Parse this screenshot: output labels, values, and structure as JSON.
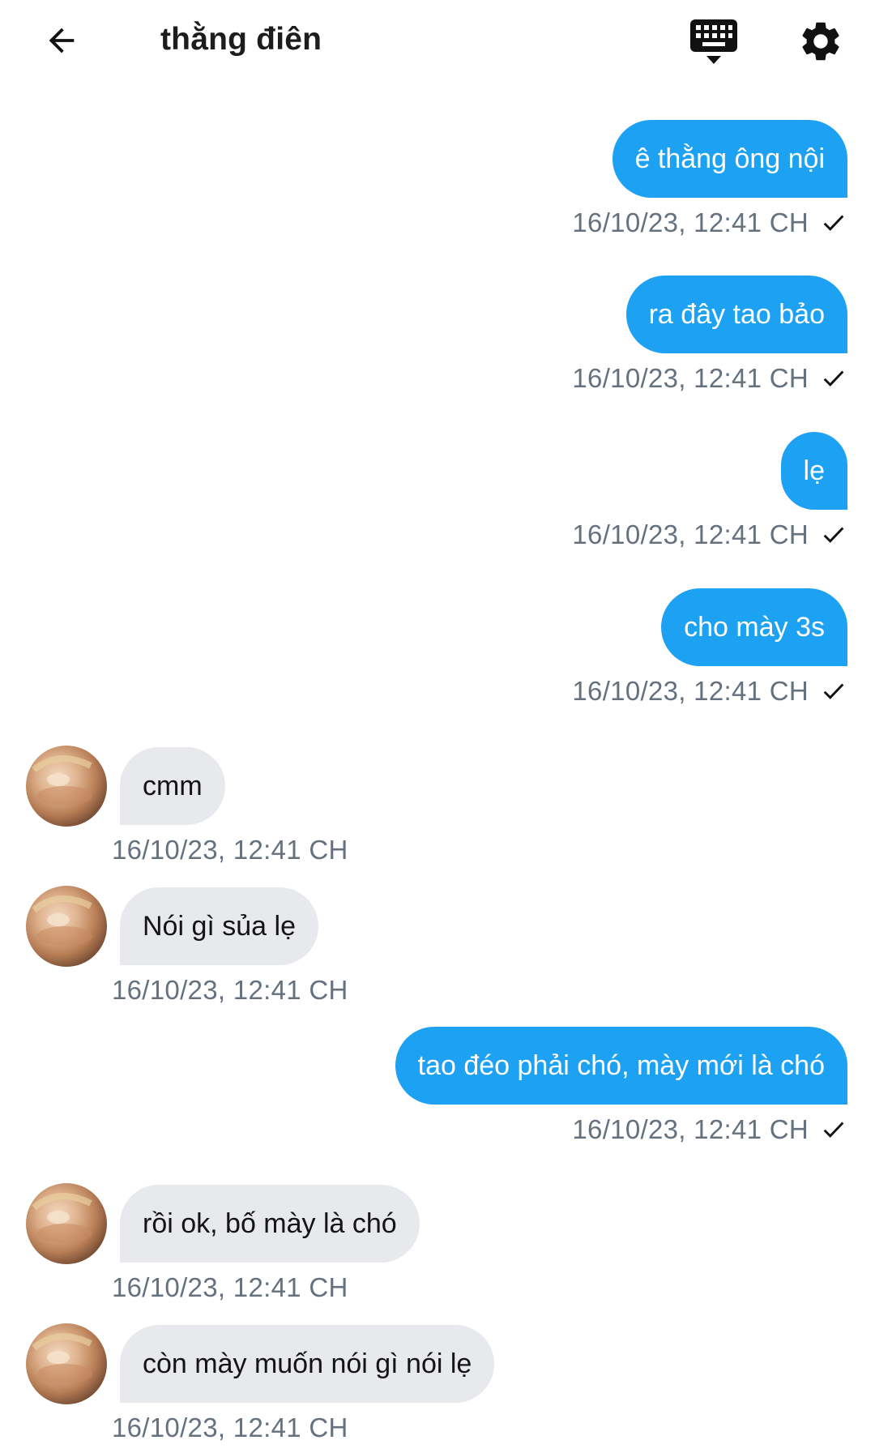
{
  "header": {
    "title": "thằng điên",
    "icons": {
      "back": "arrow-left-icon",
      "keyboard": "keyboard-icon",
      "settings": "gear-icon"
    }
  },
  "colors": {
    "outgoing_bubble": "#1DA1F2",
    "incoming_bubble": "#e7e9ec",
    "timestamp": "#65717e"
  },
  "messages": [
    {
      "direction": "out",
      "text": "ê thằng ông nội",
      "time": "16/10/23, 12:41 CH"
    },
    {
      "direction": "out",
      "text": "ra đây tao bảo",
      "time": "16/10/23, 12:41 CH"
    },
    {
      "direction": "out",
      "text": "lẹ",
      "time": "16/10/23, 12:41 CH"
    },
    {
      "direction": "out",
      "text": "cho mày 3s",
      "time": "16/10/23, 12:41 CH"
    },
    {
      "direction": "in",
      "text": "cmm",
      "time": "16/10/23, 12:41 CH"
    },
    {
      "direction": "in",
      "text": "Nói gì sủa lẹ",
      "time": "16/10/23, 12:41 CH"
    },
    {
      "direction": "out",
      "text": "tao đéo phải chó, mày mới là chó",
      "time": "16/10/23, 12:41 CH"
    },
    {
      "direction": "in",
      "text": "rồi ok, bố mày là chó",
      "time": "16/10/23, 12:41 CH"
    },
    {
      "direction": "in",
      "text": "còn mày muốn nói gì nói lẹ",
      "time": "16/10/23, 12:41 CH"
    }
  ]
}
